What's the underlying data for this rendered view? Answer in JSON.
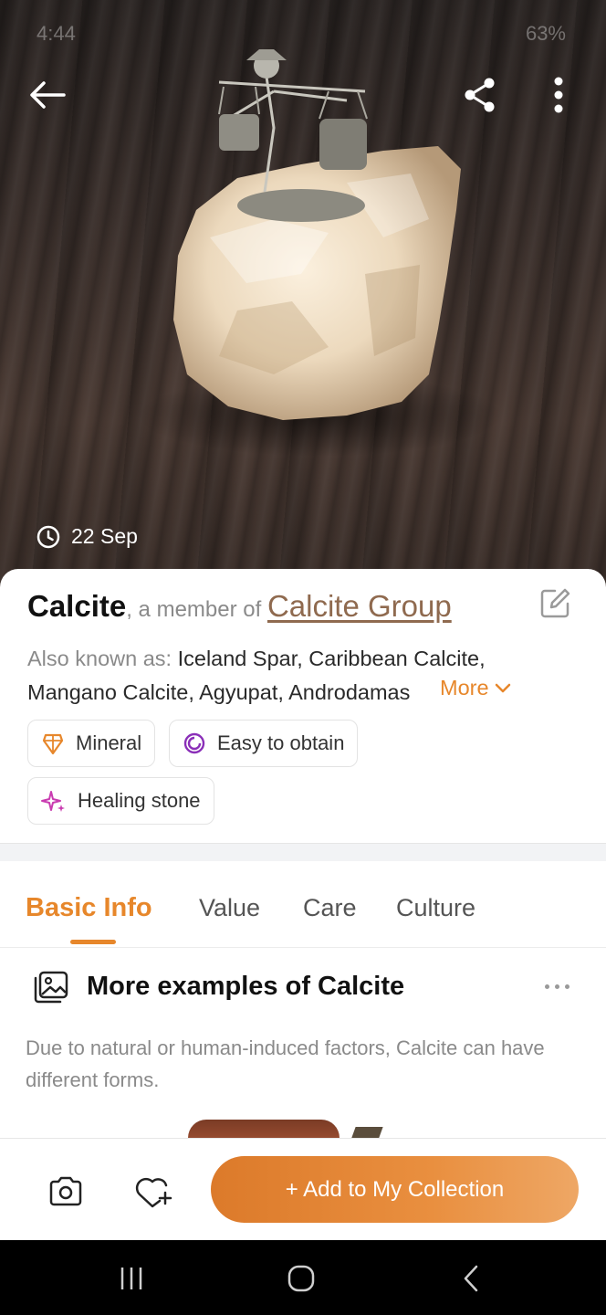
{
  "status_bar": {
    "time": "4:44",
    "battery": "63%"
  },
  "hero": {
    "date": "22 Sep"
  },
  "header": {
    "back_icon": "arrow-left-icon",
    "share_icon": "share-icon",
    "more_icon": "vertical-dots-icon"
  },
  "specimen": {
    "name": "Calcite",
    "member_prefix": ", a member of ",
    "group": "Calcite Group",
    "aka_label": "Also known as: ",
    "aka_line1": "Iceland Spar, Caribbean Calcite,",
    "aka_line2": "Mangano Calcite, Agyupat, Androdamas",
    "more_label": "More"
  },
  "chips": [
    {
      "label": "Mineral",
      "icon": "gem-shield-icon"
    },
    {
      "label": "Easy to obtain",
      "icon": "circle-arc-icon"
    },
    {
      "label": "Healing stone",
      "icon": "sparkles-icon"
    }
  ],
  "tabs": [
    {
      "label": "Basic Info",
      "active": true
    },
    {
      "label": "Value",
      "active": false
    },
    {
      "label": "Care",
      "active": false
    },
    {
      "label": "Culture",
      "active": false
    }
  ],
  "section": {
    "title": "More examples of Calcite",
    "description": "Due to natural or human-induced factors, Calcite can have different forms."
  },
  "actions": {
    "collect_label": "+ Add to My Collection",
    "camera_icon": "camera-icon",
    "favorite_icon": "heart-plus-icon"
  },
  "colors": {
    "accent": "#e7872b",
    "group_link": "#8f6a4f"
  }
}
